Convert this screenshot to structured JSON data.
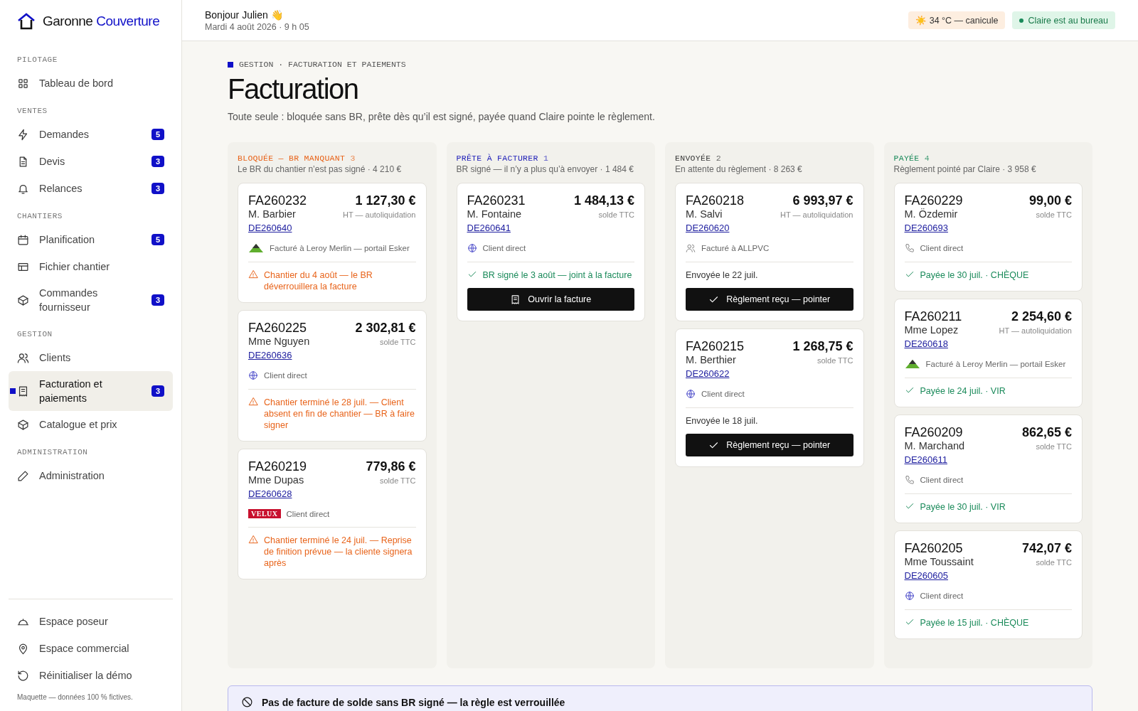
{
  "brand": {
    "name": "Garonne",
    "accent": "Couverture"
  },
  "sidebar": {
    "sections": [
      {
        "title": "PILOTAGE",
        "items": [
          {
            "kind": "grid",
            "label": "Tableau de bord",
            "selected": false
          }
        ]
      },
      {
        "title": "VENTES",
        "items": [
          {
            "kind": "bolt",
            "label": "Demandes",
            "badge": "5",
            "selected": false
          },
          {
            "kind": "file",
            "label": "Devis",
            "badge": "3",
            "selected": false
          },
          {
            "kind": "bell",
            "label": "Relances",
            "badge": "3",
            "selected": false
          }
        ]
      },
      {
        "title": "CHANTIERS",
        "items": [
          {
            "kind": "calendar",
            "label": "Planification",
            "badge": "5",
            "selected": false
          },
          {
            "kind": "table",
            "label": "Fichier chantier",
            "selected": false
          },
          {
            "kind": "box",
            "label": "Commandes fournisseur",
            "badge": "3",
            "selected": false
          }
        ]
      },
      {
        "title": "GESTION",
        "items": [
          {
            "kind": "users",
            "label": "Clients",
            "selected": false
          },
          {
            "kind": "receipt",
            "label": "Facturation et paiements",
            "badge": "3",
            "selected": true
          },
          {
            "kind": "box",
            "label": "Catalogue et prix",
            "selected": false
          }
        ]
      },
      {
        "title": "ADMINISTRATION",
        "items": [
          {
            "kind": "pencil",
            "label": "Administration",
            "selected": false
          }
        ]
      }
    ],
    "footer_items": [
      {
        "kind": "helmet",
        "label": "Espace poseur"
      },
      {
        "kind": "pin",
        "label": "Espace commercial"
      },
      {
        "kind": "reset",
        "label": "Réinitialiser la démo"
      }
    ],
    "note": "Maquette — données 100 % fictives."
  },
  "header": {
    "greeting": "Bonjour Julien 👋",
    "date": "Mardi 4 août 2026 · 9 h 05",
    "weather": "☀️ 34 °C — canicule",
    "presence": "Claire est au bureau"
  },
  "page": {
    "breadcrumb": "GESTION · FACTURATION ET PAIEMENTS",
    "title": "Facturation",
    "subtitle": "Toute seule : bloquée sans BR, prête dès qu’il est signé, payée quand Claire pointe le règlement."
  },
  "columns": [
    {
      "title": "BLOQUÉE — BR MANQUANT",
      "count": "3",
      "color": "#e8641b",
      "summary": "Le BR du chantier n’est pas signé · 4 210 €",
      "cards": [
        {
          "id": "FA260232",
          "client": "M. Barbier",
          "quote": "DE260640",
          "amount": "1 127,30 €",
          "amount_note": "HT — autoliquidation",
          "channel": {
            "kind": "leroy",
            "label": "Facturé à Leroy Merlin — portail Esker"
          },
          "status": {
            "kind": "warning",
            "text": "Chantier du 4 août — le BR déverrouillera la facture"
          }
        },
        {
          "id": "FA260225",
          "client": "Mme Nguyen",
          "quote": "DE260636",
          "amount": "2 302,81 €",
          "amount_note": "solde TTC",
          "channel": {
            "kind": "globe",
            "label": "Client direct"
          },
          "status": {
            "kind": "warning",
            "text": "Chantier terminé le 28 juil. — Client absent en fin de chantier — BR à faire signer"
          }
        },
        {
          "id": "FA260219",
          "client": "Mme Dupas",
          "quote": "DE260628",
          "amount": "779,86 €",
          "amount_note": "solde TTC",
          "channel": {
            "kind": "velux",
            "logo": "VELUX",
            "label": "Client direct"
          },
          "status": {
            "kind": "warning",
            "text": "Chantier terminé le 24 juil. — Reprise de finition prévue — la cliente signera après"
          }
        }
      ]
    },
    {
      "title": "PRÊTE À FACTURER",
      "count": "1",
      "color": "#1f1fb8",
      "summary": "BR signé — il n’y a plus qu’à envoyer · 1 484 €",
      "cards": [
        {
          "id": "FA260231",
          "client": "M. Fontaine",
          "quote": "DE260641",
          "amount": "1 484,13 €",
          "amount_note": "solde TTC",
          "channel": {
            "kind": "globe",
            "label": "Client direct"
          },
          "status": {
            "kind": "ok",
            "text": "BR signé le 3 août — joint à la facture"
          },
          "action": {
            "kind": "open",
            "label": "Ouvrir la facture"
          }
        }
      ]
    },
    {
      "title": "ENVOYÉE",
      "count": "2",
      "color": "#3a3a3a",
      "summary": "En attente du règlement · 8 263 €",
      "cards": [
        {
          "id": "FA260218",
          "client": "M. Salvi",
          "quote": "DE260620",
          "amount": "6 993,97 €",
          "amount_note": "HT — autoliquidation",
          "channel": {
            "kind": "users",
            "label": "Facturé à ALLPVC"
          },
          "status": {
            "kind": "info",
            "text": "Envoyée le 22 juil."
          },
          "action": {
            "kind": "confirm",
            "label": "Règlement reçu — pointer"
          }
        },
        {
          "id": "FA260215",
          "client": "M. Berthier",
          "quote": "DE260622",
          "amount": "1 268,75 €",
          "amount_note": "solde TTC",
          "channel": {
            "kind": "globe",
            "label": "Client direct"
          },
          "status": {
            "kind": "info",
            "text": "Envoyée le 18 juil."
          },
          "action": {
            "kind": "confirm",
            "label": "Règlement reçu — pointer"
          }
        }
      ]
    },
    {
      "title": "PAYÉE",
      "count": "4",
      "color": "#1a8a5a",
      "summary": "Règlement pointé par Claire · 3 958 €",
      "cards": [
        {
          "id": "FA260229",
          "client": "M. Özdemir",
          "quote": "DE260693",
          "amount": "99,00 €",
          "amount_note": "solde TTC",
          "channel": {
            "kind": "phone",
            "label": "Client direct"
          },
          "status": {
            "kind": "ok",
            "text": "Payée le 30 juil. · CHÈQUE"
          }
        },
        {
          "id": "FA260211",
          "client": "Mme Lopez",
          "quote": "DE260618",
          "amount": "2 254,60 €",
          "amount_note": "HT — autoliquidation",
          "channel": {
            "kind": "leroy",
            "label": "Facturé à Leroy Merlin — portail Esker"
          },
          "status": {
            "kind": "ok",
            "text": "Payée le 24 juil. · VIR"
          }
        },
        {
          "id": "FA260209",
          "client": "M. Marchand",
          "quote": "DE260611",
          "amount": "862,65 €",
          "amount_note": "solde TTC",
          "channel": {
            "kind": "phone",
            "label": "Client direct"
          },
          "status": {
            "kind": "ok",
            "text": "Payée le 30 juil. · VIR"
          }
        },
        {
          "id": "FA260205",
          "client": "Mme Toussaint",
          "quote": "DE260605",
          "amount": "742,07 €",
          "amount_note": "solde TTC",
          "channel": {
            "kind": "globe",
            "label": "Client direct"
          },
          "status": {
            "kind": "ok",
            "text": "Payée le 15 juil. · CHÈQUE"
          }
        }
      ]
    }
  ],
  "rule_banner": {
    "title": "Pas de facture de solde sans BR signé — la règle est verrouillée"
  }
}
